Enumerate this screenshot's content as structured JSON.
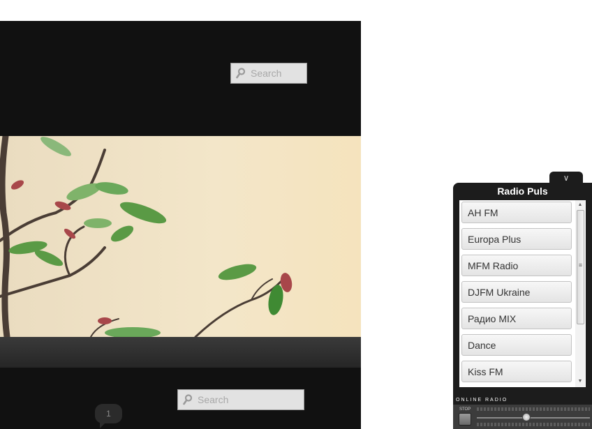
{
  "site": {
    "search_top": {
      "placeholder": "Search"
    },
    "search_bottom": {
      "placeholder": "Search"
    },
    "comment_count": "1"
  },
  "radio": {
    "toggle_icon": "chevron-down-icon",
    "toggle_glyph": "∨",
    "title": "Radio Puls",
    "stations": [
      "AH FM",
      "Europa Plus",
      "MFM Radio",
      "DJFM Ukraine",
      "Радио MIX",
      "Dance",
      "Kiss FM"
    ],
    "scroll_up_glyph": "▲",
    "scroll_down_glyph": "▼",
    "scroll_grip_glyph": "≡",
    "label": "ONLINE RADIO",
    "stop_label": "STOP",
    "volume": 0.44
  }
}
